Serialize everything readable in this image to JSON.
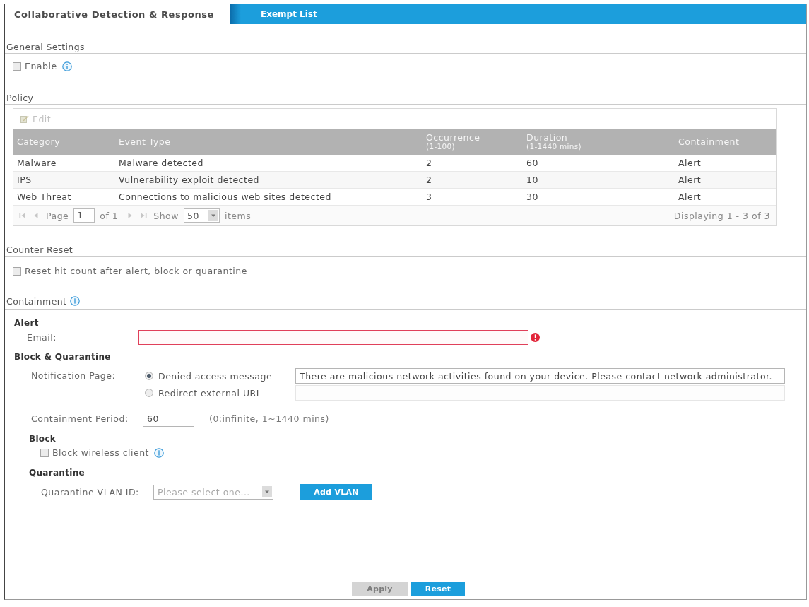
{
  "tabs": [
    {
      "label": "Collaborative Detection & Response",
      "selected": true
    },
    {
      "label": "Exempt List",
      "selected": false
    }
  ],
  "general_settings": {
    "title": "General Settings",
    "enable": {
      "label": "Enable",
      "checked": false
    }
  },
  "policy": {
    "title": "Policy",
    "edit": {
      "label": "Edit",
      "disabled": true
    },
    "table": {
      "columns": [
        {
          "label": "Category"
        },
        {
          "label": "Event Type"
        },
        {
          "label": "Occurrence",
          "sublabel": "(1-100)"
        },
        {
          "label": "Duration",
          "sublabel": "(1-1440 mins)"
        },
        {
          "label": "Containment"
        }
      ],
      "rows": [
        {
          "category": "Malware",
          "event_type": "Malware detected",
          "occurrence": "2",
          "duration": "60",
          "containment": "Alert"
        },
        {
          "category": "IPS",
          "event_type": "Vulnerability exploit detected",
          "occurrence": "2",
          "duration": "10",
          "containment": "Alert"
        },
        {
          "category": "Web Threat",
          "event_type": "Connections to malicious web sites detected",
          "occurrence": "3",
          "duration": "30",
          "containment": "Alert"
        }
      ]
    },
    "pager": {
      "nav_disabled": true,
      "page_label": "Page",
      "page": "1",
      "page_count": "of 1",
      "show_label": "Show",
      "page_size": "50",
      "items_label": "items",
      "summary": "Displaying 1 - 3 of 3"
    }
  },
  "counter_reset": {
    "title": "Counter Reset",
    "reset_hit_count": {
      "label": "Reset hit count after alert, block or quarantine",
      "checked": false
    }
  },
  "containment": {
    "title": "Containment",
    "alert": {
      "title": "Alert",
      "email": {
        "label": "Email:",
        "invalid": true
      }
    },
    "block_quarantine": {
      "title": "Block & Quarantine",
      "notification_page": {
        "label": "Notification Page:",
        "options": [
          {
            "label": "Denied access message",
            "selected": true,
            "value": "There are malicious network activities found on your device. Please contact network administrator."
          },
          {
            "label": "Redirect external URL",
            "selected": false
          }
        ]
      },
      "containment_period": {
        "label": "Containment Period:",
        "value": "60",
        "hint": "(0:infinite, 1~1440 mins)"
      },
      "block": {
        "title": "Block",
        "block_wireless_client": {
          "label": "Block wireless client",
          "checked": false
        }
      },
      "quarantine": {
        "title": "Quarantine",
        "vlan_id": {
          "label": "Quarantine VLAN ID:",
          "placeholder": "Please select one..."
        },
        "add_button": "Add VLAN"
      }
    }
  },
  "footer": {
    "buttons": [
      {
        "label": "Apply",
        "disabled": true
      },
      {
        "label": "Reset",
        "disabled": false
      }
    ]
  }
}
